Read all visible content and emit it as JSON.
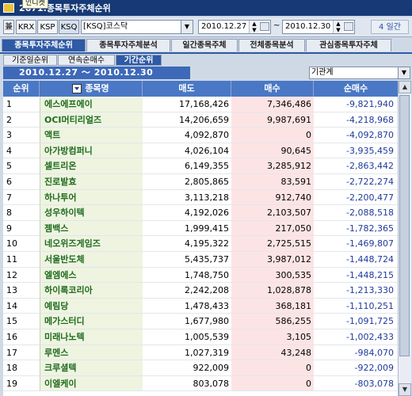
{
  "window": {
    "title": "2671.종목투자주체순위",
    "tooltip": "인디켓"
  },
  "toolbar": {
    "btn_a": "兼",
    "btn_krx": "KRX",
    "btn_ksp": "KSP",
    "btn_ksq": "KSQ",
    "market_select": "[KSQ]코스닥",
    "date_from": "2010.12.27",
    "date_sep": "~",
    "date_to": "2010.12.30",
    "period_label": "4 일간"
  },
  "tabs_main": [
    "종목투자주체순위",
    "종목투자주체분석",
    "일간종목주체",
    "전체종목분석",
    "관심종목투자주체"
  ],
  "tabs_sub": [
    "기준일순위",
    "연속순매수",
    "기간순위"
  ],
  "range": {
    "label": "2010.12.27 ～ 2010.12.30",
    "investor_select": "기관계"
  },
  "table": {
    "headers": {
      "rank": "순위",
      "name": "종목명",
      "sell": "매도",
      "buy": "매수",
      "net": "순매수"
    },
    "rows": [
      {
        "rank": "1",
        "name": "에스에프에이",
        "sell": "17,168,426",
        "buy": "7,346,486",
        "net": "-9,821,940"
      },
      {
        "rank": "2",
        "name": "OCI머티리얼즈",
        "sell": "14,206,659",
        "buy": "9,987,691",
        "net": "-4,218,968"
      },
      {
        "rank": "3",
        "name": "액트",
        "sell": "4,092,870",
        "buy": "0",
        "net": "-4,092,870"
      },
      {
        "rank": "4",
        "name": "아가방컴퍼니",
        "sell": "4,026,104",
        "buy": "90,645",
        "net": "-3,935,459"
      },
      {
        "rank": "5",
        "name": "셀트리온",
        "sell": "6,149,355",
        "buy": "3,285,912",
        "net": "-2,863,442"
      },
      {
        "rank": "6",
        "name": "진로발효",
        "sell": "2,805,865",
        "buy": "83,591",
        "net": "-2,722,274"
      },
      {
        "rank": "7",
        "name": "하나투어",
        "sell": "3,113,218",
        "buy": "912,740",
        "net": "-2,200,477"
      },
      {
        "rank": "8",
        "name": "성우하이텍",
        "sell": "4,192,026",
        "buy": "2,103,507",
        "net": "-2,088,518"
      },
      {
        "rank": "9",
        "name": "젬백스",
        "sell": "1,999,415",
        "buy": "217,050",
        "net": "-1,782,365"
      },
      {
        "rank": "10",
        "name": "네오위즈게임즈",
        "sell": "4,195,322",
        "buy": "2,725,515",
        "net": "-1,469,807"
      },
      {
        "rank": "11",
        "name": "서울반도체",
        "sell": "5,435,737",
        "buy": "3,987,012",
        "net": "-1,448,724"
      },
      {
        "rank": "12",
        "name": "엘엠에스",
        "sell": "1,748,750",
        "buy": "300,535",
        "net": "-1,448,215"
      },
      {
        "rank": "13",
        "name": "하이록코리아",
        "sell": "2,242,208",
        "buy": "1,028,878",
        "net": "-1,213,330"
      },
      {
        "rank": "14",
        "name": "예림당",
        "sell": "1,478,433",
        "buy": "368,181",
        "net": "-1,110,251"
      },
      {
        "rank": "15",
        "name": "메가스터디",
        "sell": "1,677,980",
        "buy": "586,255",
        "net": "-1,091,725"
      },
      {
        "rank": "16",
        "name": "미래나노텍",
        "sell": "1,005,539",
        "buy": "3,105",
        "net": "-1,002,433"
      },
      {
        "rank": "17",
        "name": "루멘스",
        "sell": "1,027,319",
        "buy": "43,248",
        "net": "-984,070"
      },
      {
        "rank": "18",
        "name": "크루셜텍",
        "sell": "922,009",
        "buy": "0",
        "net": "-922,009"
      },
      {
        "rank": "19",
        "name": "이엘케이",
        "sell": "803,078",
        "buy": "0",
        "net": "-803,078"
      }
    ]
  }
}
